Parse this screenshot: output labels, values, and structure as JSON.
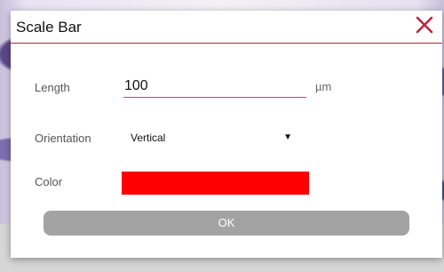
{
  "dialog": {
    "title": "Scale Bar",
    "close_icon": "close-icon"
  },
  "fields": {
    "length_label": "Length",
    "length_value": "100",
    "length_unit": "µm",
    "orientation_label": "Orientation",
    "orientation_value": "Vertical",
    "orientation_icon": "chevron-down-icon",
    "color_label": "Color",
    "color_value": "#ff0000"
  },
  "actions": {
    "ok_label": "OK"
  },
  "colors": {
    "accent": "#c0233a",
    "button_bg": "#a3a3a3"
  }
}
